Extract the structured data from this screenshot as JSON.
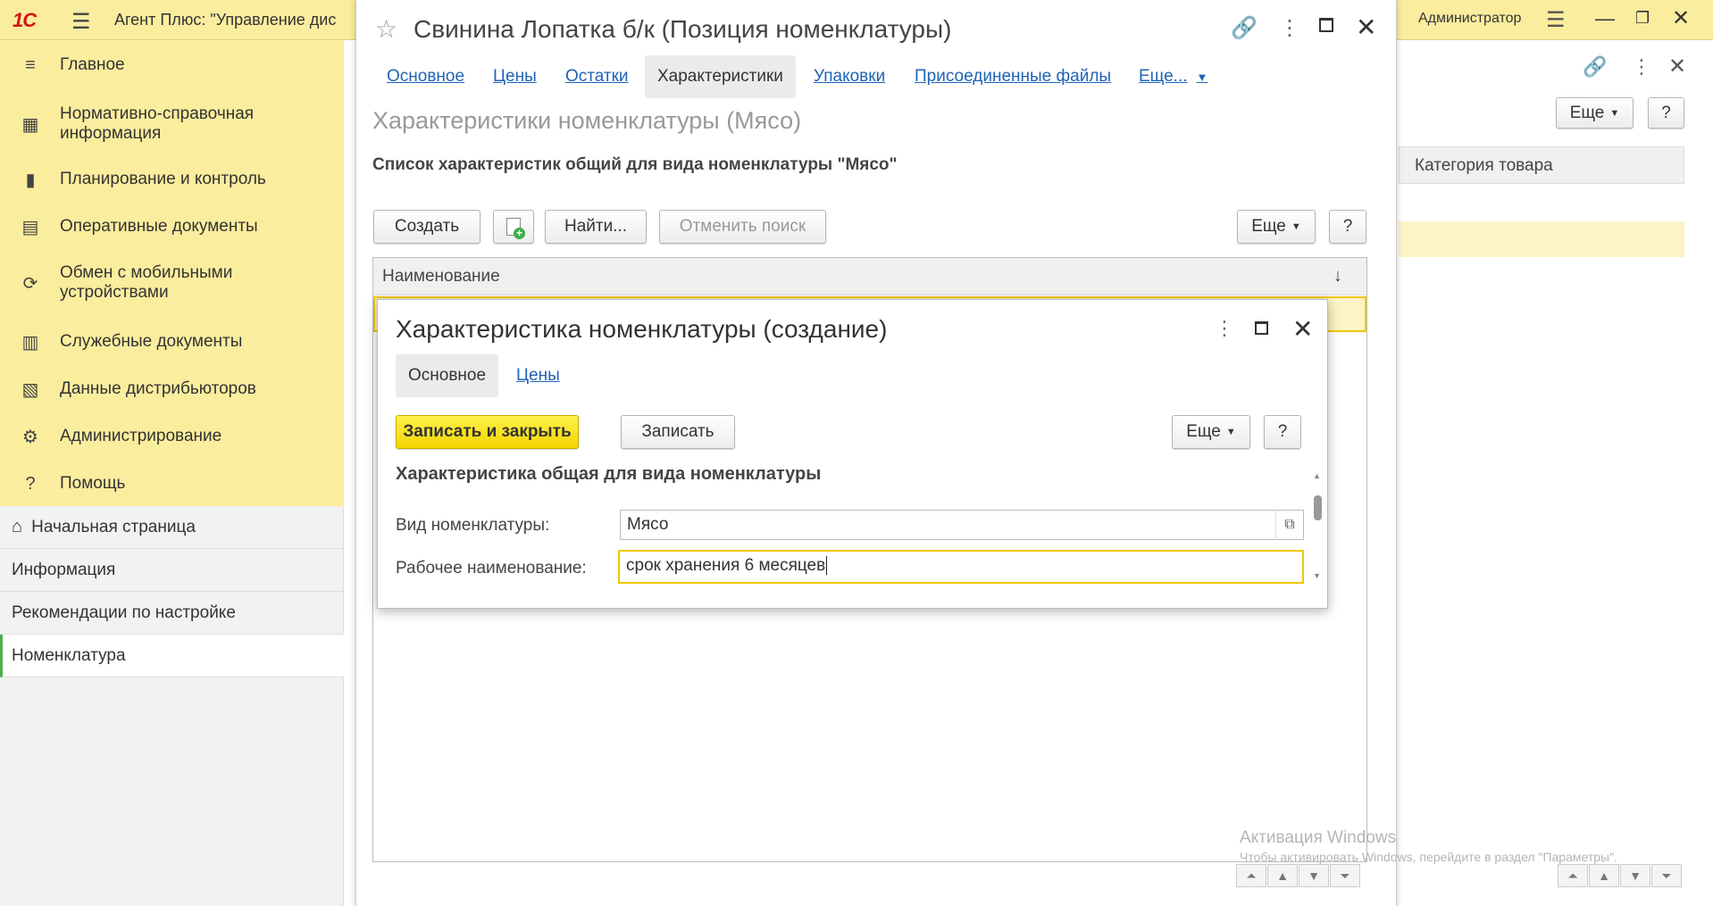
{
  "app": {
    "logo": "1С",
    "title": "Агент Плюс: \"Управление дис",
    "user": "Администратор"
  },
  "sidebar": {
    "items": [
      {
        "icon": "menu-lines-icon",
        "glyph": "≡",
        "label": "Главное"
      },
      {
        "icon": "grid-icon",
        "glyph": "▦",
        "label": "Нормативно-справочная информация"
      },
      {
        "icon": "bar-chart-icon",
        "glyph": "▮",
        "label": "Планирование и контроль"
      },
      {
        "icon": "documents-icon",
        "glyph": "▤",
        "label": "Оперативные документы"
      },
      {
        "icon": "sync-icon",
        "glyph": "⟳",
        "label": "Обмен с мобильными устройствами"
      },
      {
        "icon": "service-docs-icon",
        "glyph": "▥",
        "label": "Служебные документы"
      },
      {
        "icon": "distributor-data-icon",
        "glyph": "▧",
        "label": "Данные дистрибьюторов"
      },
      {
        "icon": "gear-icon",
        "glyph": "⚙",
        "label": "Администрирование"
      },
      {
        "icon": "help-icon",
        "glyph": "?",
        "label": "Помощь"
      }
    ]
  },
  "navpanel": {
    "home": "Начальная страница",
    "home_glyph": "⌂",
    "items": [
      "Информация",
      "Рекомендации по настройке",
      "Номенклатура"
    ]
  },
  "bgwindow": {
    "more": "Еще",
    "help": "?",
    "column": "Категория товара"
  },
  "mainform": {
    "title": "Свинина Лопатка б/к (Позиция номенклатуры)",
    "tabs": [
      "Основное",
      "Цены",
      "Остатки",
      "Характеристики",
      "Упаковки",
      "Присоединенные файлы",
      "Еще..."
    ],
    "section": "Характеристики номенклатуры (Мясо)",
    "description": "Список характеристик общий для вида номенклатуры \"Мясо\"",
    "toolbar": {
      "create": "Создать",
      "find": "Найти...",
      "cancel_search": "Отменить поиск",
      "more": "Еще",
      "help": "?"
    },
    "list_column": "Наименование",
    "sort_glyph": "↓"
  },
  "dialog": {
    "title": "Характеристика номенклатуры (создание)",
    "tabs": [
      "Основное",
      "Цены"
    ],
    "save_close": "Записать и закрыть",
    "save": "Записать",
    "more": "Еще",
    "help": "?",
    "section": "Характеристика общая для вида номенклатуры",
    "fields": {
      "kind_label": "Вид номенклатуры:",
      "kind_value": "Мясо",
      "name_label": "Рабочее наименование:",
      "name_value": "срок хранения 6 месяцев"
    }
  },
  "watermark": {
    "line1": "Активация Windows",
    "line2": "Чтобы активировать Windows, перейдите в раздел \"Параметры\"."
  },
  "colors": {
    "accent_yellow": "#fbed9e",
    "link_blue": "#2063b5",
    "primary_button": "#f2d500",
    "logo_red": "#d4141b"
  }
}
